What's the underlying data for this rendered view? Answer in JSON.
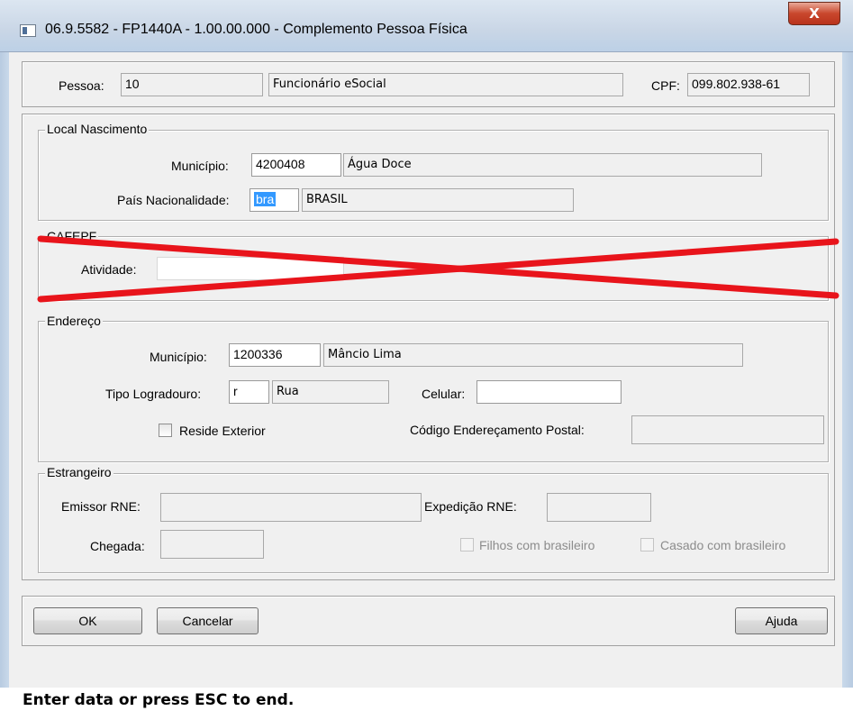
{
  "window": {
    "title": "06.9.5582 - FP1440A - 1.00.00.000 - Complemento Pessoa Física",
    "close_glyph": "X"
  },
  "header": {
    "pessoa_label": "Pessoa:",
    "pessoa_value": "10",
    "pessoa_name": "Funcionário eSocial",
    "cpf_label": "CPF:",
    "cpf_value": "099.802.938-61"
  },
  "local_nascimento": {
    "legend": "Local Nascimento",
    "municipio_label": "Município:",
    "municipio_code": "4200408",
    "municipio_name": "Água Doce",
    "pais_label": "País Nacionalidade:",
    "pais_code": "bra",
    "pais_name": "BRASIL"
  },
  "cafepf": {
    "legend": "CAFEPF",
    "atividade_label": "Atividade:",
    "atividade_value": "",
    "strike_color": "#e8141b"
  },
  "endereco": {
    "legend": "Endereço",
    "municipio_label": "Município:",
    "municipio_code": "1200336",
    "municipio_name": "Mâncio Lima",
    "tipo_logradouro_label": "Tipo Logradouro:",
    "tipo_logradouro_code": "r",
    "tipo_logradouro_name": "Rua",
    "celular_label": "Celular:",
    "celular_value": "",
    "reside_exterior_label": "Reside Exterior",
    "cep_label": "Código Endereçamento Postal:",
    "cep_value": ""
  },
  "estrangeiro": {
    "legend": "Estrangeiro",
    "emissor_rne_label": "Emissor RNE:",
    "emissor_rne_value": "",
    "expedicao_rne_label": "Expedição RNE:",
    "expedicao_rne_value": "",
    "chegada_label": "Chegada:",
    "chegada_value": "",
    "filhos_label": "Filhos com brasileiro",
    "casado_label": "Casado com brasileiro"
  },
  "buttons": {
    "ok": "OK",
    "cancelar": "Cancelar",
    "ajuda": "Ajuda"
  },
  "status": {
    "text": "Enter data or press ESC to end."
  }
}
